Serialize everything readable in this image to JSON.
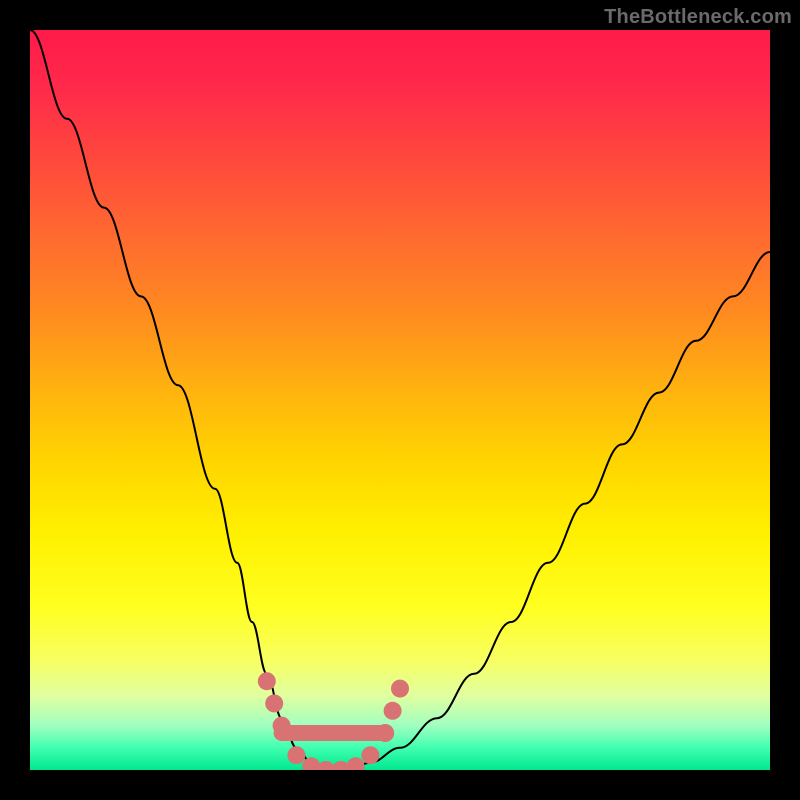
{
  "watermark": "TheBottleneck.com",
  "chart_data": {
    "type": "line",
    "title": "",
    "xlabel": "",
    "ylabel": "",
    "xlim": [
      0,
      100
    ],
    "ylim": [
      0,
      100
    ],
    "grid": false,
    "legend": false,
    "background_gradient": {
      "top": "#ff1a4a",
      "mid": "#fff000",
      "bottom": "#00e890"
    },
    "series": [
      {
        "name": "bottleneck-curve",
        "x": [
          0,
          5,
          10,
          15,
          20,
          25,
          28,
          30,
          32,
          34,
          36,
          38,
          40,
          43,
          46,
          50,
          55,
          60,
          65,
          70,
          75,
          80,
          85,
          90,
          95,
          100
        ],
        "values": [
          100,
          88,
          76,
          64,
          52,
          38,
          28,
          20,
          13,
          7,
          3,
          1,
          0,
          0,
          1,
          3,
          7,
          13,
          20,
          28,
          36,
          44,
          51,
          58,
          64,
          70
        ]
      }
    ],
    "markers": {
      "name": "marker-dots",
      "color": "#d97272",
      "points": [
        {
          "x": 32,
          "y": 12
        },
        {
          "x": 33,
          "y": 9
        },
        {
          "x": 34,
          "y": 6
        },
        {
          "x": 36,
          "y": 2
        },
        {
          "x": 38,
          "y": 0.5
        },
        {
          "x": 40,
          "y": 0
        },
        {
          "x": 42,
          "y": 0
        },
        {
          "x": 44,
          "y": 0.5
        },
        {
          "x": 46,
          "y": 2
        },
        {
          "x": 48,
          "y": 5
        },
        {
          "x": 49,
          "y": 8
        },
        {
          "x": 50,
          "y": 11
        }
      ]
    },
    "annotations": []
  }
}
